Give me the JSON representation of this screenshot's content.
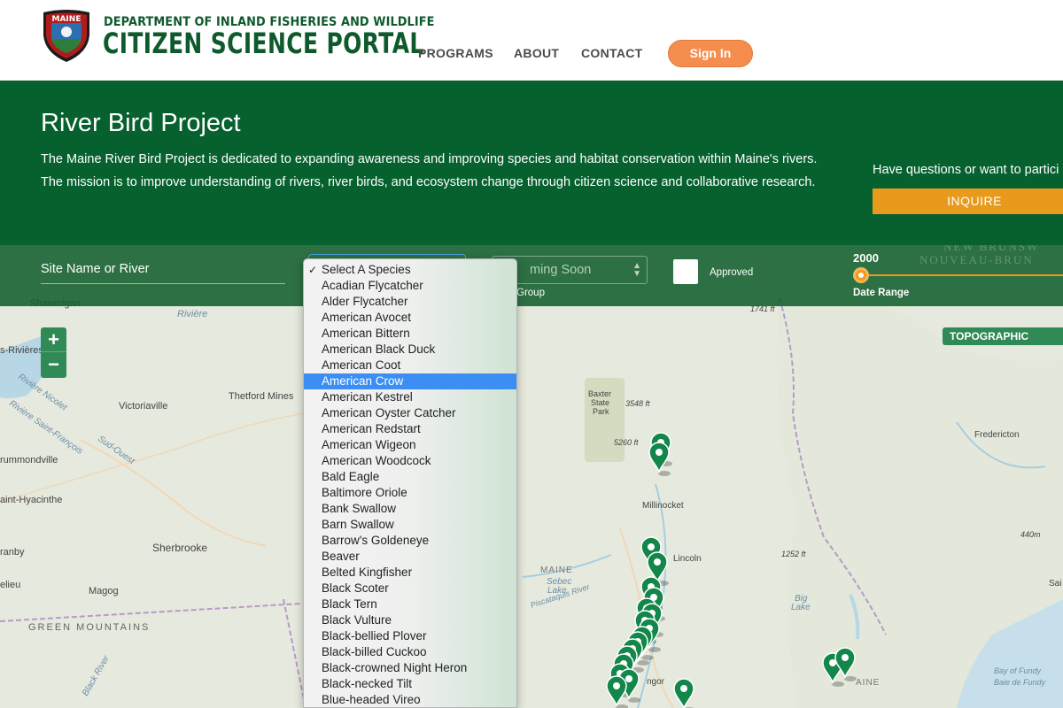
{
  "header": {
    "department": "DEPARTMENT OF INLAND FISHERIES AND WILDLIFE",
    "portal": "CITIZEN SCIENCE PORTAL",
    "logo_text": "MAINE",
    "nav": [
      "PROGRAMS",
      "ABOUT",
      "CONTACT"
    ],
    "signin": "Sign In"
  },
  "banner": {
    "title": "River Bird Project",
    "description": "The Maine River Bird Project is dedicated to expanding awareness and improving species and habitat conservation within Maine's rivers. The mission is to improve understanding of rivers, river birds, and ecosystem change through citizen science and collaborative research.",
    "side_question": "Have questions or want to partici",
    "inquire": "INQUIRE"
  },
  "filters": {
    "site_placeholder": "Site Name or River",
    "group_value": "ming Soon",
    "group_label": "Group",
    "approved_label": "Approved",
    "date_value": "2000",
    "date_label": "Date Range"
  },
  "map": {
    "layer_label": "TOPOGRAPHIC",
    "zoom_in": "+",
    "zoom_out": "−",
    "labels": {
      "shawinigan": "Shawinigan",
      "trois_rivieres": "s-Rivières",
      "riviere": "Rivière",
      "victoriaville": "Victoriaville",
      "thetford": "Thetford Mines",
      "drummondville": "rummondville",
      "saint_hyacinthe": "aint-Hyacinthe",
      "sherbrooke": "Sherbrooke",
      "granby": "ranby",
      "elieu": "elieu",
      "magog": "Magog",
      "green_mountains": "GREEN MOUNTAINS",
      "black_river": "Black River",
      "baxter1": "Baxter",
      "baxter2": "State",
      "baxter3": "Park",
      "elev_3548": "3548 ft",
      "elev_5260": "5260 ft",
      "elev_1741": "1741 ft",
      "elev_1252": "1252 ft",
      "elev_440": "440m",
      "millinocket": "Millinocket",
      "lincoln": "Lincoln",
      "maine": "MAINE",
      "sebec1": "Sebec",
      "sebec2": "Lake",
      "piscataquis": "Piscataquis River",
      "big1": "Big",
      "big2": "Lake",
      "ngor": "ngor",
      "fredericton": "Fredericton",
      "saint_side": "Sai",
      "new_brunswick": "NEW BRUNSW",
      "nouveau": "NOUVEAU-BRUN",
      "aine": "AINE",
      "bay_fundy1": "Bay of Fundy",
      "bay_fundy2": "Baie de Fundy",
      "riviere_nicolet": "Rivière Nicolet",
      "saint_francois": "Rivière Saint-François",
      "sud_ouest": "Sud-Ouest"
    },
    "colors": {
      "marker": "#13864a",
      "land": "#e8ebdf",
      "water": "#b7d6e6"
    }
  },
  "species_dropdown": {
    "selected_index": 6,
    "options": [
      "Select A Species",
      "Acadian Flycatcher",
      "Alder Flycatcher",
      "American Avocet",
      "American Bittern",
      "American Black Duck",
      "American Coot",
      "American Crow",
      "American Kestrel",
      "American Oyster Catcher",
      "American Redstart",
      "American Wigeon",
      "American Woodcock",
      "Bald Eagle",
      "Baltimore Oriole",
      "Bank Swallow",
      "Barn Swallow",
      "Barrow's Goldeneye",
      "Beaver",
      "Belted Kingfisher",
      "Black Scoter",
      "Black Tern",
      "Black Vulture",
      "Black-bellied Plover",
      "Black-billed Cuckoo",
      "Black-crowned Night Heron",
      "Black-necked Tilt",
      "Blue-headed Vireo"
    ],
    "checked_index": 0,
    "checkmark": "✓"
  }
}
